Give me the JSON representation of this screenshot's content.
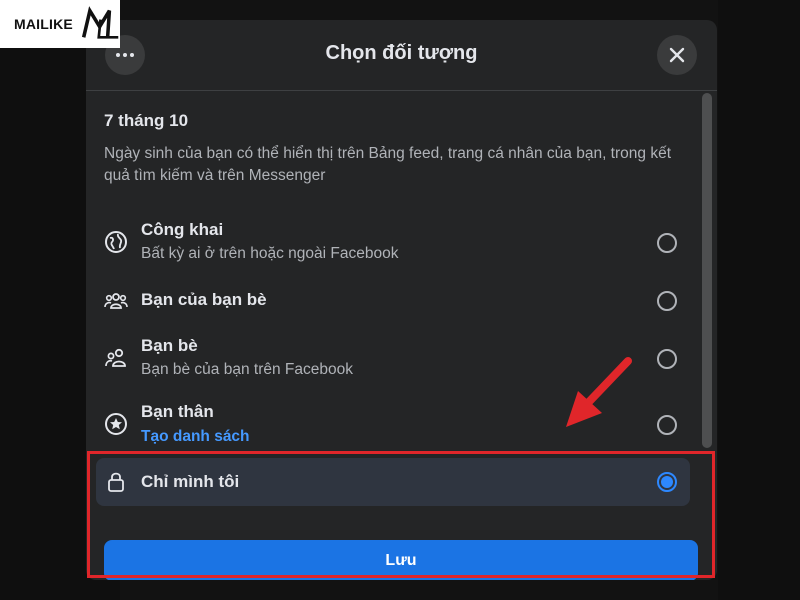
{
  "watermark": {
    "brand": "MAILIKE"
  },
  "dialog": {
    "title": "Chọn đối tượng",
    "more_icon": "more-icon",
    "close_icon": "close-icon"
  },
  "content": {
    "date": "7 tháng 10",
    "description": "Ngày sinh của bạn có thể hiển thị trên Bảng feed, trang cá nhân của bạn, trong kết quả tìm kiếm và trên Messenger"
  },
  "options": [
    {
      "icon": "globe-icon",
      "title": "Công khai",
      "subtitle": "Bất kỳ ai ở trên hoặc ngoài Facebook",
      "selected": false
    },
    {
      "icon": "friends-of-friends-icon",
      "title": "Bạn của bạn bè",
      "subtitle": "",
      "selected": false
    },
    {
      "icon": "friends-icon",
      "title": "Bạn bè",
      "subtitle": "Bạn bè của bạn trên Facebook",
      "selected": false
    },
    {
      "icon": "star-icon",
      "title": "Bạn thân",
      "link": "Tạo danh sách",
      "selected": false
    },
    {
      "icon": "lock-icon",
      "title": "Chỉ mình tôi",
      "subtitle": "",
      "selected": true
    }
  ],
  "save_button": {
    "label": "Lưu"
  },
  "colors": {
    "accent": "#1b74e4",
    "selected_radio": "#2d88ff",
    "highlight_box": "#e0262a",
    "link": "#4599ff"
  }
}
